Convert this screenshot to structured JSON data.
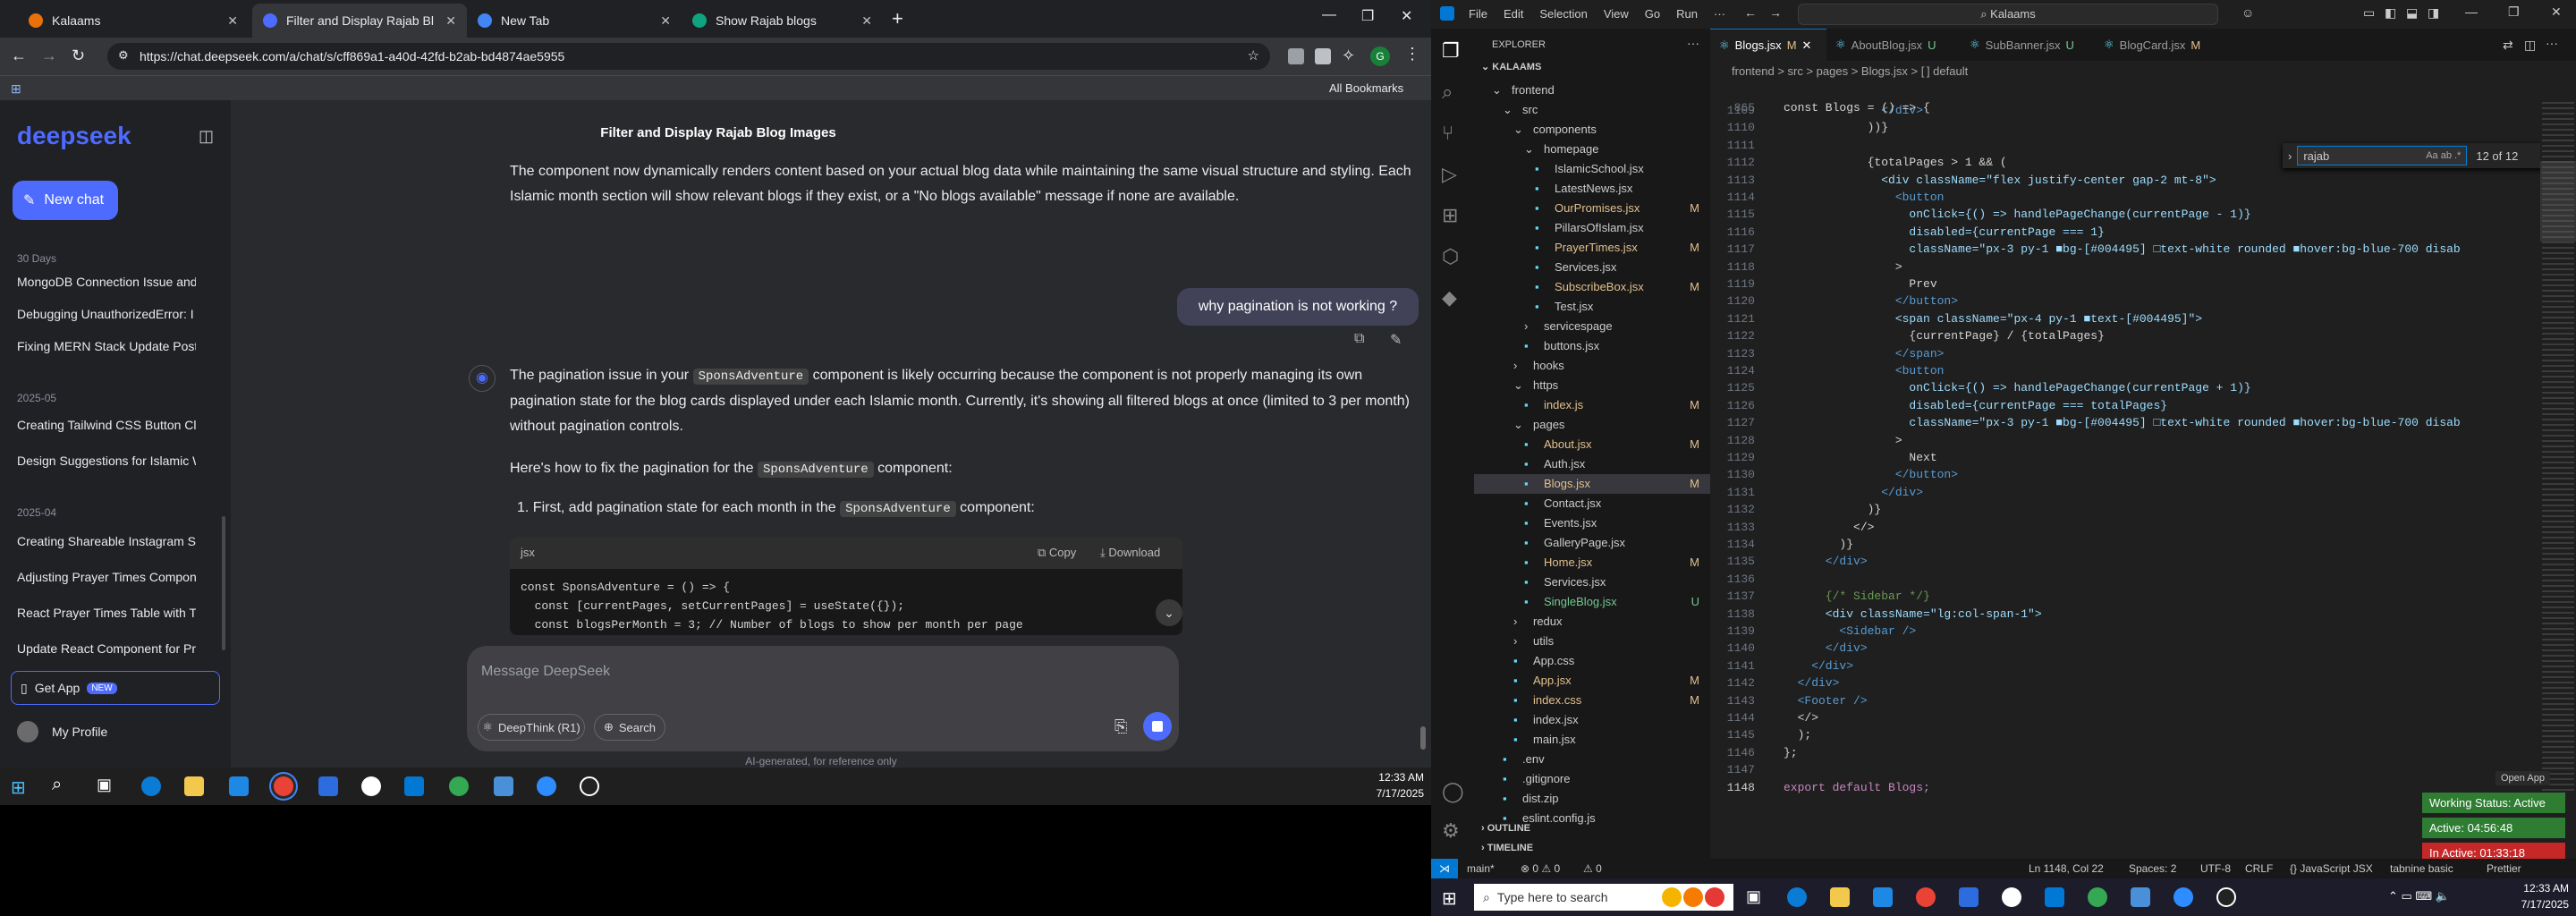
{
  "browser": {
    "tabs": [
      {
        "label": "Kalaams",
        "color": "#e8710a"
      },
      {
        "label": "Filter and Display Rajab Blog In",
        "color": "#4d6bfe"
      },
      {
        "label": "New Tab",
        "color": "#4285f4"
      },
      {
        "label": "Show Rajab blogs",
        "color": "#10a37f"
      }
    ],
    "url": "https://chat.deepseek.com/a/chat/s/cff869a1-a40d-42fd-b2ab-bd4874ae5955",
    "all_bookmarks": "All Bookmarks"
  },
  "deepseek": {
    "logo": "deepseek",
    "new_chat": "New chat",
    "sections": [
      {
        "head": "30 Days",
        "items": [
          "MongoDB Connection Issue and",
          "Debugging UnauthorizedError: I",
          "Fixing MERN Stack Update Post I"
        ]
      },
      {
        "head": "2025-05",
        "items": [
          "Creating Tailwind CSS Button Cla",
          "Design Suggestions for Islamic W"
        ]
      },
      {
        "head": "2025-04",
        "items": [
          "Creating Shareable Instagram St",
          "Adjusting Prayer Times Compon",
          "React Prayer Times Table with Ta",
          "Update React Component for Pr"
        ]
      }
    ],
    "get_app": "Get App",
    "new_badge": "NEW",
    "profile": "My Profile",
    "chat_title": "Filter and Display Rajab Blog Images",
    "prev_reply": "The component now dynamically renders content based on your actual blog data while maintaining the same visual structure and styling. Each Islamic month section will show relevant blogs if they exist, or a \"No blogs available\" message if none are available.",
    "user_msg": "why pagination is not working ?",
    "reply_p1a": "The pagination issue in your ",
    "reply_p1_code": "SponsAdventure",
    "reply_p1b": " component is likely occurring because the component is not properly managing its own pagination state for the blog cards displayed under each Islamic month. Currently, it's showing all filtered blogs at once (limited to 3 per month) without pagination controls.",
    "reply_p2a": "Here's how to fix the pagination for the ",
    "reply_p2_code": "SponsAdventure",
    "reply_p2b": " component:",
    "reply_li_num": "1.",
    "reply_li1a": "First, add pagination state for each month in the ",
    "reply_li1_code": "SponsAdventure",
    "reply_li1b": " component:",
    "code_lang": "jsx",
    "copy": "Copy",
    "download": "Download",
    "code_lines": [
      "const SponsAdventure = () => {",
      "  const [currentPages, setCurrentPages] = useState({});",
      "  const blogsPerMonth = 3; // Number of blogs to show per month per page"
    ],
    "input_placeholder": "Message DeepSeek",
    "deepthink": "DeepThink (R1)",
    "search": "Search",
    "footer": "AI-generated, for reference only"
  },
  "taskbar_left": {
    "time": "12:33 AM",
    "date": "7/17/2025"
  },
  "vscode": {
    "menu": [
      "File",
      "Edit",
      "Selection",
      "View",
      "Go",
      "Run",
      "···"
    ],
    "search": "Kalaams",
    "explorer_title": "EXPLORER",
    "root": "KALAAMS",
    "tree": [
      {
        "name": "frontend",
        "indent": 1,
        "type": "folder",
        "open": true
      },
      {
        "name": "src",
        "indent": 2,
        "type": "folder",
        "open": true
      },
      {
        "name": "components",
        "indent": 3,
        "type": "folder",
        "open": true
      },
      {
        "name": "homepage",
        "indent": 4,
        "type": "folder",
        "open": true
      },
      {
        "name": "IslamicSchool.jsx",
        "indent": 5,
        "type": "file",
        "mark": ""
      },
      {
        "name": "LatestNews.jsx",
        "indent": 5,
        "type": "file",
        "mark": ""
      },
      {
        "name": "OurPromises.jsx",
        "indent": 5,
        "type": "file",
        "mark": "M"
      },
      {
        "name": "PillarsOfIslam.jsx",
        "indent": 5,
        "type": "file",
        "mark": ""
      },
      {
        "name": "PrayerTimes.jsx",
        "indent": 5,
        "type": "file",
        "mark": "M"
      },
      {
        "name": "Services.jsx",
        "indent": 5,
        "type": "file",
        "mark": ""
      },
      {
        "name": "SubscribeBox.jsx",
        "indent": 5,
        "type": "file",
        "mark": "M"
      },
      {
        "name": "Test.jsx",
        "indent": 5,
        "type": "file",
        "mark": ""
      },
      {
        "name": "servicespage",
        "indent": 4,
        "type": "folder",
        "open": false
      },
      {
        "name": "buttons.jsx",
        "indent": 4,
        "type": "file",
        "mark": ""
      },
      {
        "name": "hooks",
        "indent": 3,
        "type": "folder",
        "open": false
      },
      {
        "name": "https",
        "indent": 3,
        "type": "folder",
        "open": true
      },
      {
        "name": "index.js",
        "indent": 4,
        "type": "file",
        "mark": "M"
      },
      {
        "name": "pages",
        "indent": 3,
        "type": "folder",
        "open": true
      },
      {
        "name": "About.jsx",
        "indent": 4,
        "type": "file",
        "mark": "M"
      },
      {
        "name": "Auth.jsx",
        "indent": 4,
        "type": "file",
        "mark": ""
      },
      {
        "name": "Blogs.jsx",
        "indent": 4,
        "type": "file",
        "mark": "M",
        "selected": true
      },
      {
        "name": "Contact.jsx",
        "indent": 4,
        "type": "file",
        "mark": ""
      },
      {
        "name": "Events.jsx",
        "indent": 4,
        "type": "file",
        "mark": ""
      },
      {
        "name": "GalleryPage.jsx",
        "indent": 4,
        "type": "file",
        "mark": ""
      },
      {
        "name": "Home.jsx",
        "indent": 4,
        "type": "file",
        "mark": "M"
      },
      {
        "name": "Services.jsx",
        "indent": 4,
        "type": "file",
        "mark": ""
      },
      {
        "name": "SingleBlog.jsx",
        "indent": 4,
        "type": "file",
        "mark": "U"
      },
      {
        "name": "redux",
        "indent": 3,
        "type": "folder",
        "open": false
      },
      {
        "name": "utils",
        "indent": 3,
        "type": "folder",
        "open": false
      },
      {
        "name": "App.css",
        "indent": 3,
        "type": "file",
        "mark": ""
      },
      {
        "name": "App.jsx",
        "indent": 3,
        "type": "file",
        "mark": "M"
      },
      {
        "name": "index.css",
        "indent": 3,
        "type": "file",
        "mark": "M"
      },
      {
        "name": "index.jsx",
        "indent": 3,
        "type": "file",
        "mark": ""
      },
      {
        "name": "main.jsx",
        "indent": 3,
        "type": "file",
        "mark": ""
      },
      {
        "name": ".env",
        "indent": 2,
        "type": "file",
        "mark": ""
      },
      {
        "name": ".gitignore",
        "indent": 2,
        "type": "file",
        "mark": ""
      },
      {
        "name": "dist.zip",
        "indent": 2,
        "type": "file",
        "mark": ""
      },
      {
        "name": "eslint.config.js",
        "indent": 2,
        "type": "file",
        "mark": ""
      }
    ],
    "outline": "OUTLINE",
    "timeline": "TIMELINE",
    "tabs": [
      {
        "label": "Blogs.jsx",
        "mark": "M",
        "active": true
      },
      {
        "label": "AboutBlog.jsx",
        "mark": "U"
      },
      {
        "label": "SubBanner.jsx",
        "mark": "U"
      },
      {
        "label": "BlogCard.jsx",
        "mark": "M"
      }
    ],
    "breadcrumb": "frontend > src > pages > Blogs.jsx > [ ] default",
    "sticky": "const Blogs = () => {",
    "find_query": "rajab",
    "find_count": "12 of 12",
    "lines": [
      {
        "n": "1109",
        "t": "              </div>"
      },
      {
        "n": "1110",
        "t": "            ))}"
      },
      {
        "n": "1111",
        "t": ""
      },
      {
        "n": "1112",
        "t": "            {totalPages > 1 && ("
      },
      {
        "n": "1113",
        "t": "              <div className=\"flex justify-center gap-2 mt-8\">"
      },
      {
        "n": "1114",
        "t": "                <button"
      },
      {
        "n": "1115",
        "t": "                  onClick={() => handlePageChange(currentPage - 1)}"
      },
      {
        "n": "1116",
        "t": "                  disabled={currentPage === 1}"
      },
      {
        "n": "1117",
        "t": "                  className=\"px-3 py-1 ■bg-[#004495] □text-white rounded ■hover:bg-blue-700 disab"
      },
      {
        "n": "1118",
        "t": "                >"
      },
      {
        "n": "1119",
        "t": "                  Prev"
      },
      {
        "n": "1120",
        "t": "                </button>"
      },
      {
        "n": "1121",
        "t": "                <span className=\"px-4 py-1 ■text-[#004495]\">"
      },
      {
        "n": "1122",
        "t": "                  {currentPage} / {totalPages}"
      },
      {
        "n": "1123",
        "t": "                </span>"
      },
      {
        "n": "1124",
        "t": "                <button"
      },
      {
        "n": "1125",
        "t": "                  onClick={() => handlePageChange(currentPage + 1)}"
      },
      {
        "n": "1126",
        "t": "                  disabled={currentPage === totalPages}"
      },
      {
        "n": "1127",
        "t": "                  className=\"px-3 py-1 ■bg-[#004495] □text-white rounded ■hover:bg-blue-700 disab"
      },
      {
        "n": "1128",
        "t": "                >"
      },
      {
        "n": "1129",
        "t": "                  Next"
      },
      {
        "n": "1130",
        "t": "                </button>"
      },
      {
        "n": "1131",
        "t": "              </div>"
      },
      {
        "n": "1132",
        "t": "            )}"
      },
      {
        "n": "1133",
        "t": "          </>"
      },
      {
        "n": "1134",
        "t": "        )}"
      },
      {
        "n": "1135",
        "t": "      </div>"
      },
      {
        "n": "1136",
        "t": ""
      },
      {
        "n": "1137",
        "t": "      {/* Sidebar */}"
      },
      {
        "n": "1138",
        "t": "      <div className=\"lg:col-span-1\">"
      },
      {
        "n": "1139",
        "t": "        <Sidebar />"
      },
      {
        "n": "1140",
        "t": "      </div>"
      },
      {
        "n": "1141",
        "t": "    </div>"
      },
      {
        "n": "1142",
        "t": "  </div>"
      },
      {
        "n": "1143",
        "t": "  <Footer />"
      },
      {
        "n": "1144",
        "t": "  </>"
      },
      {
        "n": "1145",
        "t": "  );"
      },
      {
        "n": "1146",
        "t": "};"
      },
      {
        "n": "1147",
        "t": ""
      },
      {
        "n": "1148",
        "t": "export default Blogs;"
      }
    ],
    "open_app": "Open App",
    "working_status": "Working Status: Active",
    "active_time": "Active: 04:56:48",
    "inactive_time": "In Active: 01:33:18",
    "status_left": [
      "main*",
      "⊗ 0 ⚠ 0",
      "⚠ 0"
    ],
    "status_right": [
      "Ln 1148, Col 22",
      "Spaces: 2",
      "UTF-8",
      "CRLF",
      "{} JavaScript JSX",
      "tabnine basic",
      "Prettier"
    ],
    "search_placeholder": "Type here to search",
    "time": "12:33 AM",
    "date": "7/17/2025"
  }
}
